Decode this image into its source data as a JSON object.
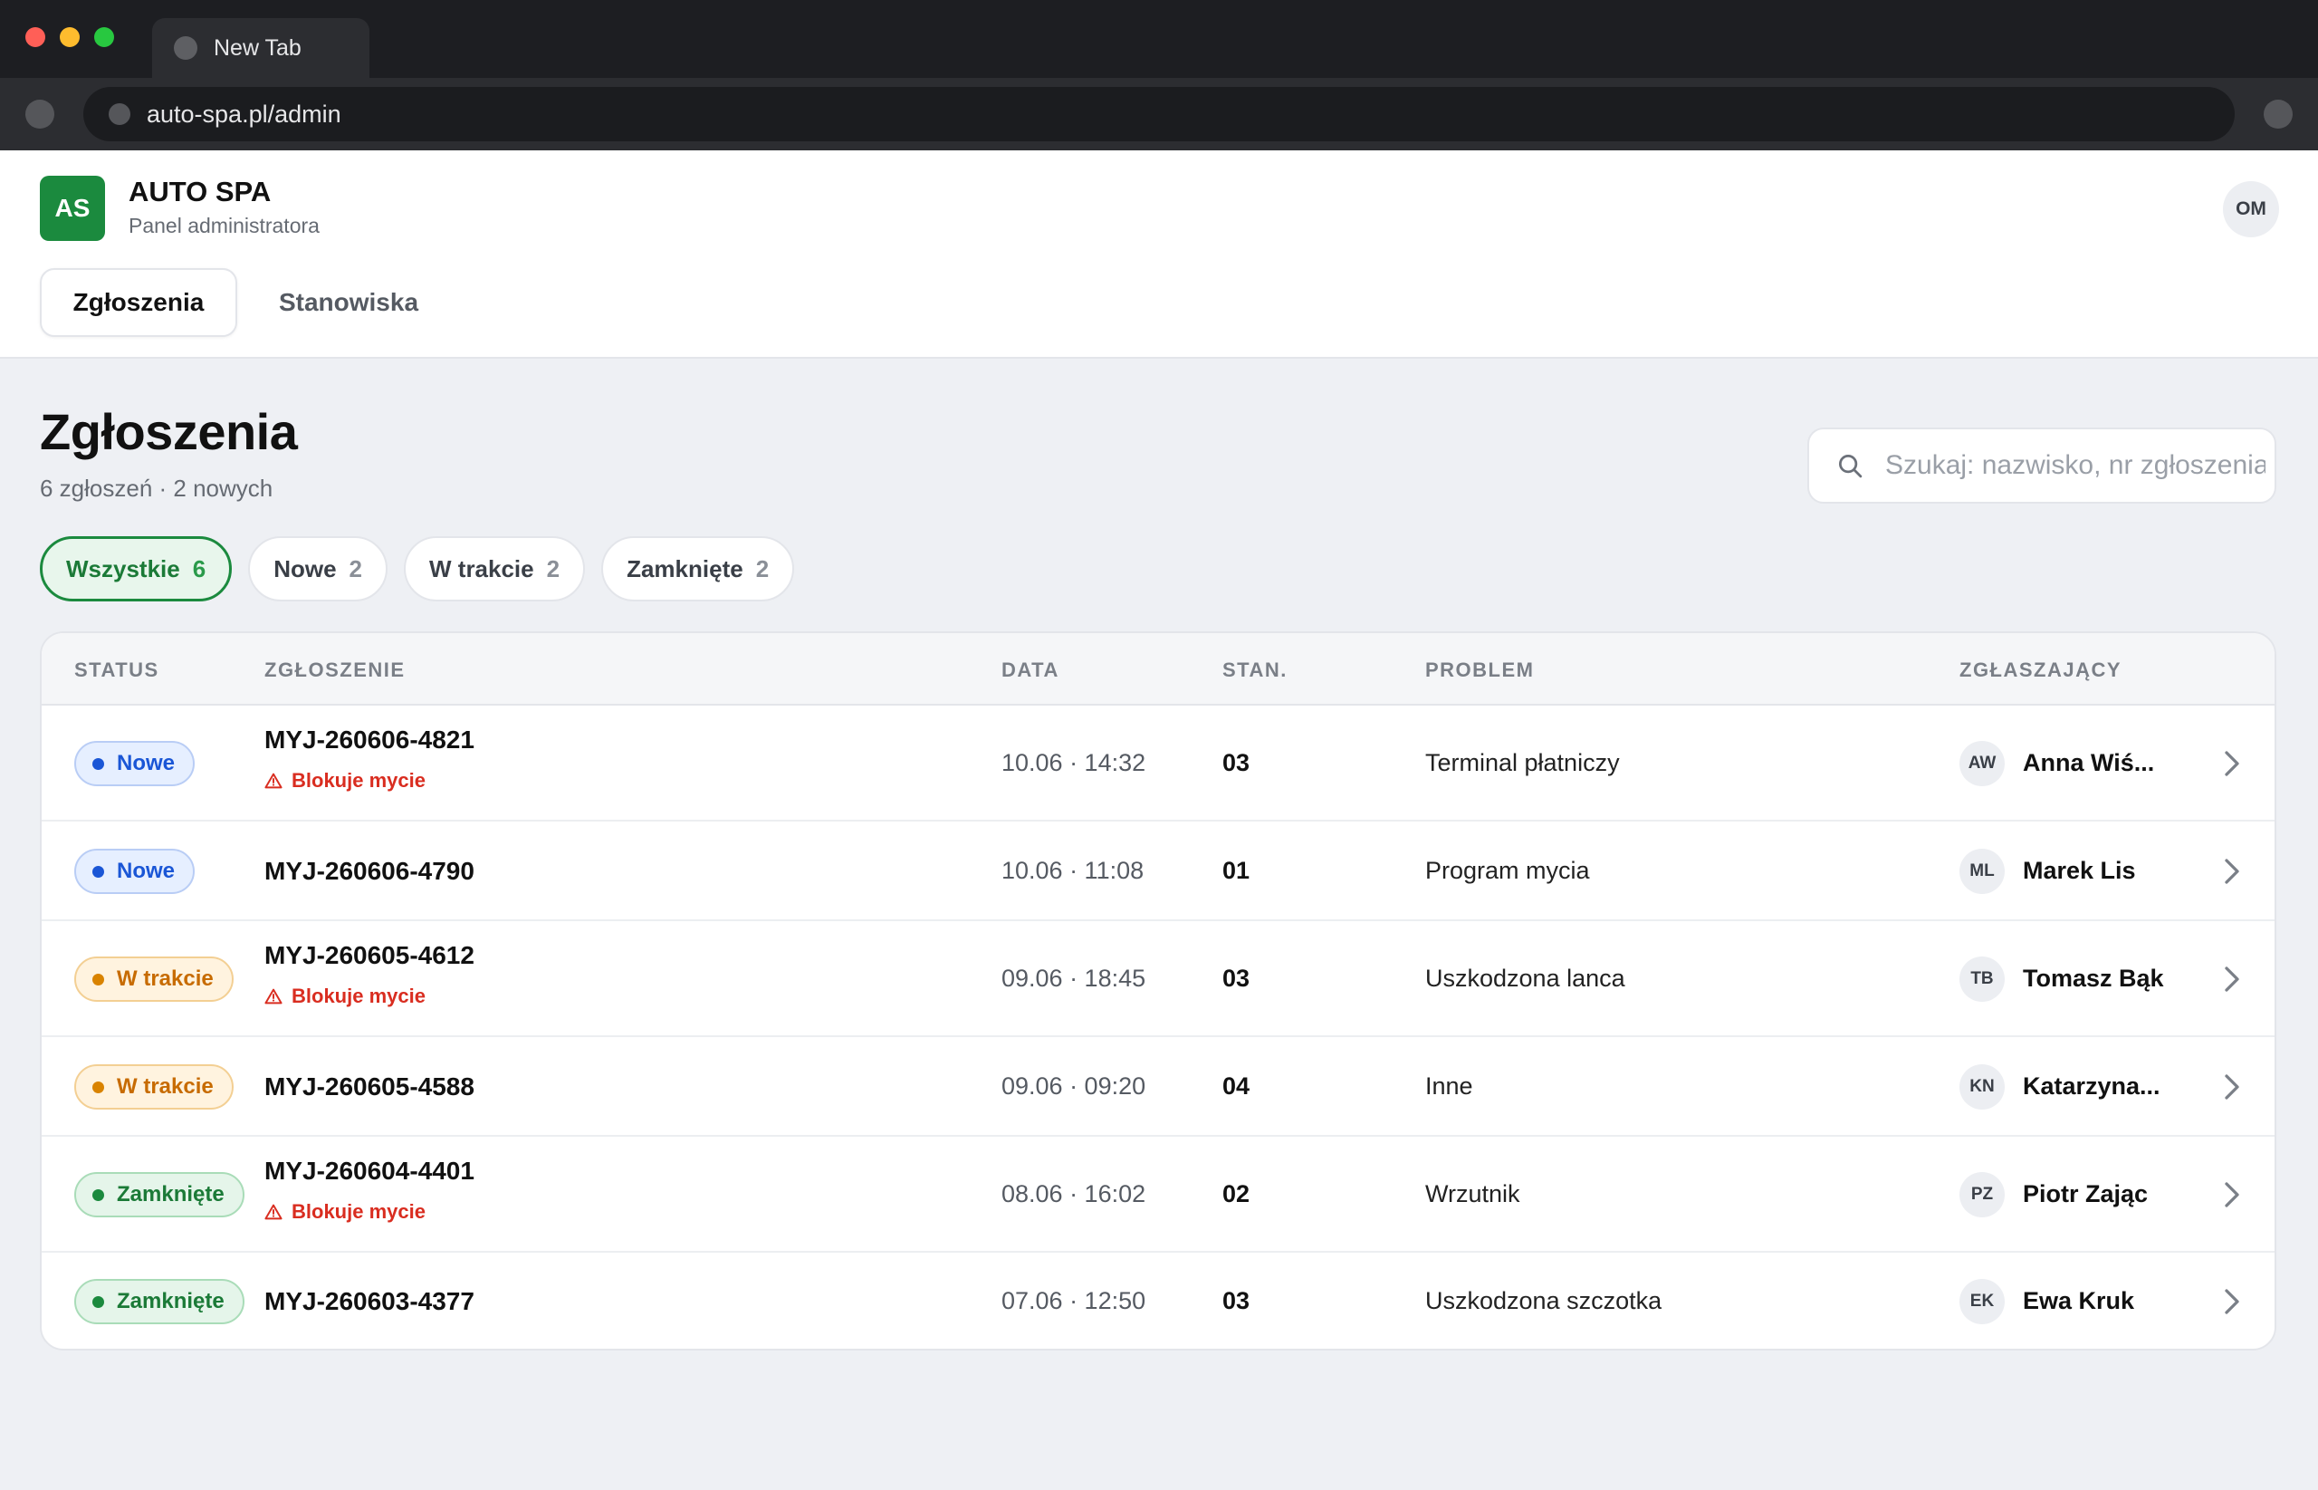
{
  "browser": {
    "tab_title": "New Tab",
    "url": "auto-spa.pl/admin"
  },
  "app": {
    "logo_initials": "AS",
    "name": "AUTO SPA",
    "subtitle": "Panel administratora",
    "user_initials": "OM",
    "nav": [
      {
        "label": "Zgłoszenia",
        "active": true
      },
      {
        "label": "Stanowiska",
        "active": false
      }
    ]
  },
  "page": {
    "title": "Zgłoszenia",
    "summary": "6 zgłoszeń · 2 nowych",
    "search_placeholder": "Szukaj: nazwisko, nr zgłoszenia"
  },
  "filters": [
    {
      "label": "Wszystkie",
      "count": "6",
      "active": true
    },
    {
      "label": "Nowe",
      "count": "2",
      "active": false
    },
    {
      "label": "W trakcie",
      "count": "2",
      "active": false
    },
    {
      "label": "Zamknięte",
      "count": "2",
      "active": false
    }
  ],
  "table": {
    "headers": {
      "status": "STATUS",
      "ticket": "ZGŁOSZENIE",
      "date": "DATA",
      "stand": "STAN.",
      "problem": "PROBLEM",
      "reporter": "ZGŁASZAJĄCY"
    },
    "rows": [
      {
        "status": "Nowe",
        "status_kind": "new",
        "ticket": "MYJ-260606-4821",
        "blocker": "Blokuje mycie",
        "date": "10.06 · 14:32",
        "stand": "03",
        "problem": "Terminal płatniczy",
        "initials": "AW",
        "name": "Anna Wiś..."
      },
      {
        "status": "Nowe",
        "status_kind": "new",
        "ticket": "MYJ-260606-4790",
        "blocker": "",
        "date": "10.06 · 11:08",
        "stand": "01",
        "problem": "Program mycia",
        "initials": "ML",
        "name": "Marek Lis"
      },
      {
        "status": "W trakcie",
        "status_kind": "prog",
        "ticket": "MYJ-260605-4612",
        "blocker": "Blokuje mycie",
        "date": "09.06 · 18:45",
        "stand": "03",
        "problem": "Uszkodzona lanca",
        "initials": "TB",
        "name": "Tomasz Bąk"
      },
      {
        "status": "W trakcie",
        "status_kind": "prog",
        "ticket": "MYJ-260605-4588",
        "blocker": "",
        "date": "09.06 · 09:20",
        "stand": "04",
        "problem": "Inne",
        "initials": "KN",
        "name": "Katarzyna..."
      },
      {
        "status": "Zamknięte",
        "status_kind": "closed",
        "ticket": "MYJ-260604-4401",
        "blocker": "Blokuje mycie",
        "date": "08.06 · 16:02",
        "stand": "02",
        "problem": "Wrzutnik",
        "initials": "PZ",
        "name": "Piotr Zając"
      },
      {
        "status": "Zamknięte",
        "status_kind": "closed",
        "ticket": "MYJ-260603-4377",
        "blocker": "",
        "date": "07.06 · 12:50",
        "stand": "03",
        "problem": "Uszkodzona szczotka",
        "initials": "EK",
        "name": "Ewa Kruk"
      }
    ]
  },
  "icons": {
    "search": "search-icon",
    "blocker": "warning-icon",
    "row_action": "chevron-right-icon"
  },
  "colors": {
    "brand": "#1b8a3e",
    "status_new": "#1a56d6",
    "status_in_progress": "#d98300",
    "status_closed": "#1b8a3e",
    "blocker": "#d92d20"
  }
}
